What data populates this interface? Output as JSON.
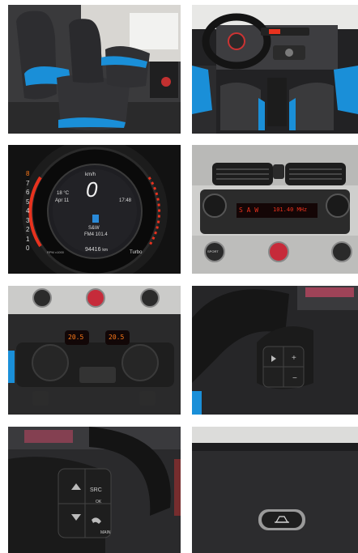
{
  "photos": [
    {
      "subject": "front-seats"
    },
    {
      "subject": "dashboard-overview"
    },
    {
      "subject": "instrument-cluster"
    },
    {
      "subject": "radio-head-unit"
    },
    {
      "subject": "climate-control"
    },
    {
      "subject": "steering-wheel-right-controls"
    },
    {
      "subject": "steering-wheel-left-controls"
    },
    {
      "subject": "dashboard-top-button"
    }
  ],
  "cluster": {
    "speed_unit": "km/h",
    "speed": "0",
    "temp": "18 °C",
    "date": "Apr 11",
    "time": "17:48",
    "station_name": "S&W",
    "station_freq": "FM4 101.4",
    "odometer": "94416",
    "odometer_unit": "km",
    "rpm_unit": "RPM x1000",
    "mode": "Turbo",
    "rpm_ticks": [
      "8",
      "7",
      "6",
      "5",
      "4",
      "3",
      "2",
      "1",
      "0"
    ]
  },
  "radio": {
    "display_station": "S A W",
    "display_freq": "101.40 MHz",
    "button_left": "SPORT"
  },
  "climate": {
    "left_temp": "20.5",
    "right_temp": "20.5"
  },
  "steering_left": {
    "src_label": "SRC",
    "ok_label": "OK",
    "main_label": "MAIN"
  },
  "colors": {
    "accent_blue": "#1a8fd8",
    "display_red": "#e8321e",
    "display_amber": "#ff7a1a"
  }
}
